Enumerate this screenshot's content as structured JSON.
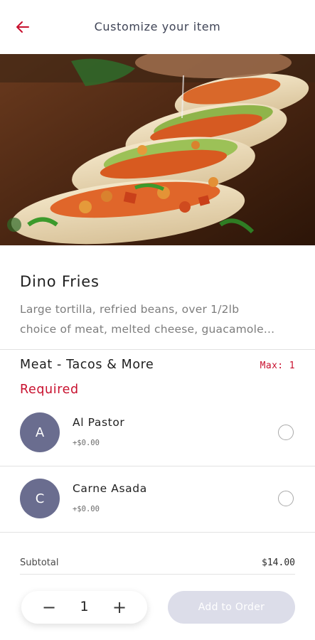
{
  "header": {
    "title": "Customize your item",
    "back_icon": "arrow-left-icon",
    "accent_color": "#c8102e"
  },
  "item": {
    "name": "Dino Fries",
    "description_lines": [
      "Large tortilla, refried beans, over 1/2lb",
      "choice of meat, melted cheese, guacamole..."
    ]
  },
  "modifier_group": {
    "title": "Meat - Tacos & More",
    "max_label": "Max: 1",
    "required_label": "Required",
    "options": [
      {
        "initial": "A",
        "name": "Al Pastor",
        "price": "+$0.00",
        "selected": false
      },
      {
        "initial": "C",
        "name": "Carne Asada",
        "price": "+$0.00",
        "selected": false
      }
    ]
  },
  "footer": {
    "subtotal_label": "Subtotal",
    "subtotal_value": "$14.00",
    "quantity": "1",
    "minus_symbol": "−",
    "plus_symbol": "+",
    "add_button_label": "Add to Order",
    "add_button_state": "disabled"
  }
}
